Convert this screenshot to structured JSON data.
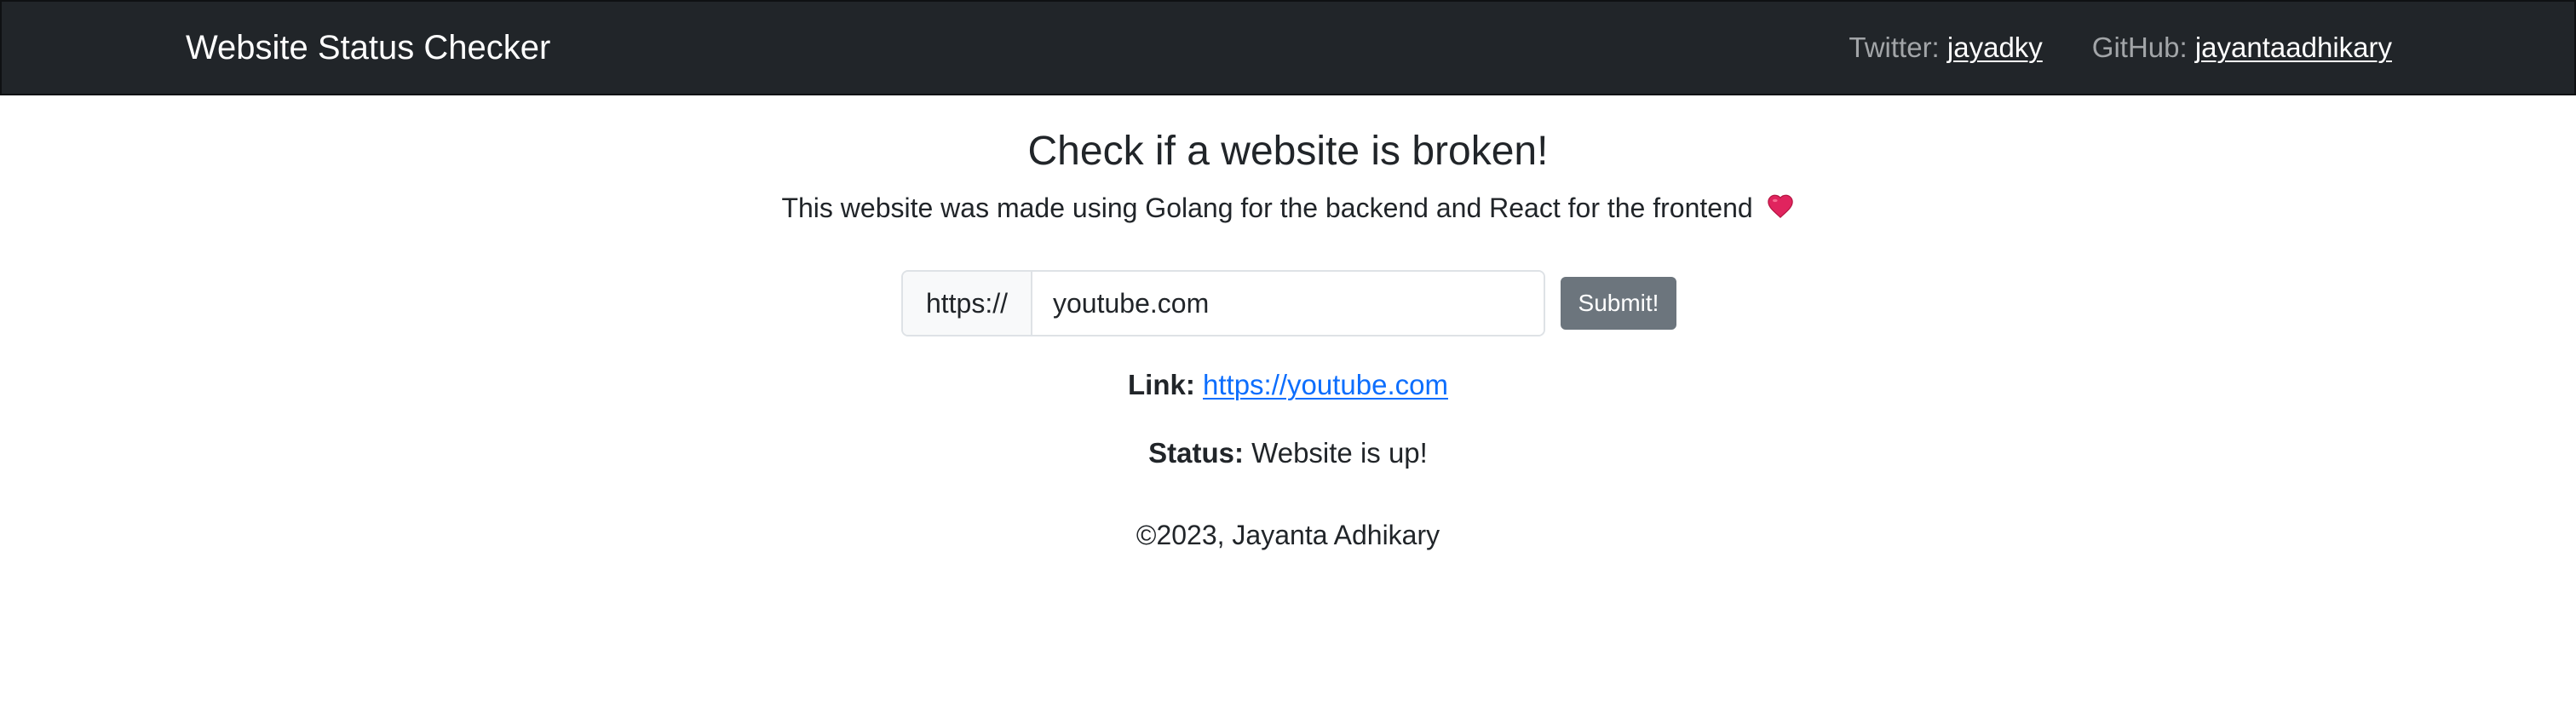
{
  "navbar": {
    "brand": "Website Status Checker",
    "twitter_label": "Twitter:",
    "twitter_handle": "jayadky",
    "github_label": "GitHub:",
    "github_handle": "jayantaadhikary"
  },
  "main": {
    "heading": "Check if a website is broken!",
    "subtitle": "This website was made using Golang for the backend and React for the frontend",
    "subtitle_icon": "heart-icon",
    "form": {
      "prefix": "https://",
      "input_value": "youtube.com",
      "submit_label": "Submit!"
    },
    "result": {
      "link_label": "Link:",
      "link_value": "https://youtube.com",
      "status_label": "Status:",
      "status_value": "Website is up!"
    },
    "footer": "©2023, Jayanta Adhikary"
  },
  "colors": {
    "navbar_bg": "#212529",
    "link": "#0d6efd",
    "button_bg": "#6c757d",
    "heart": "#e0245e"
  }
}
